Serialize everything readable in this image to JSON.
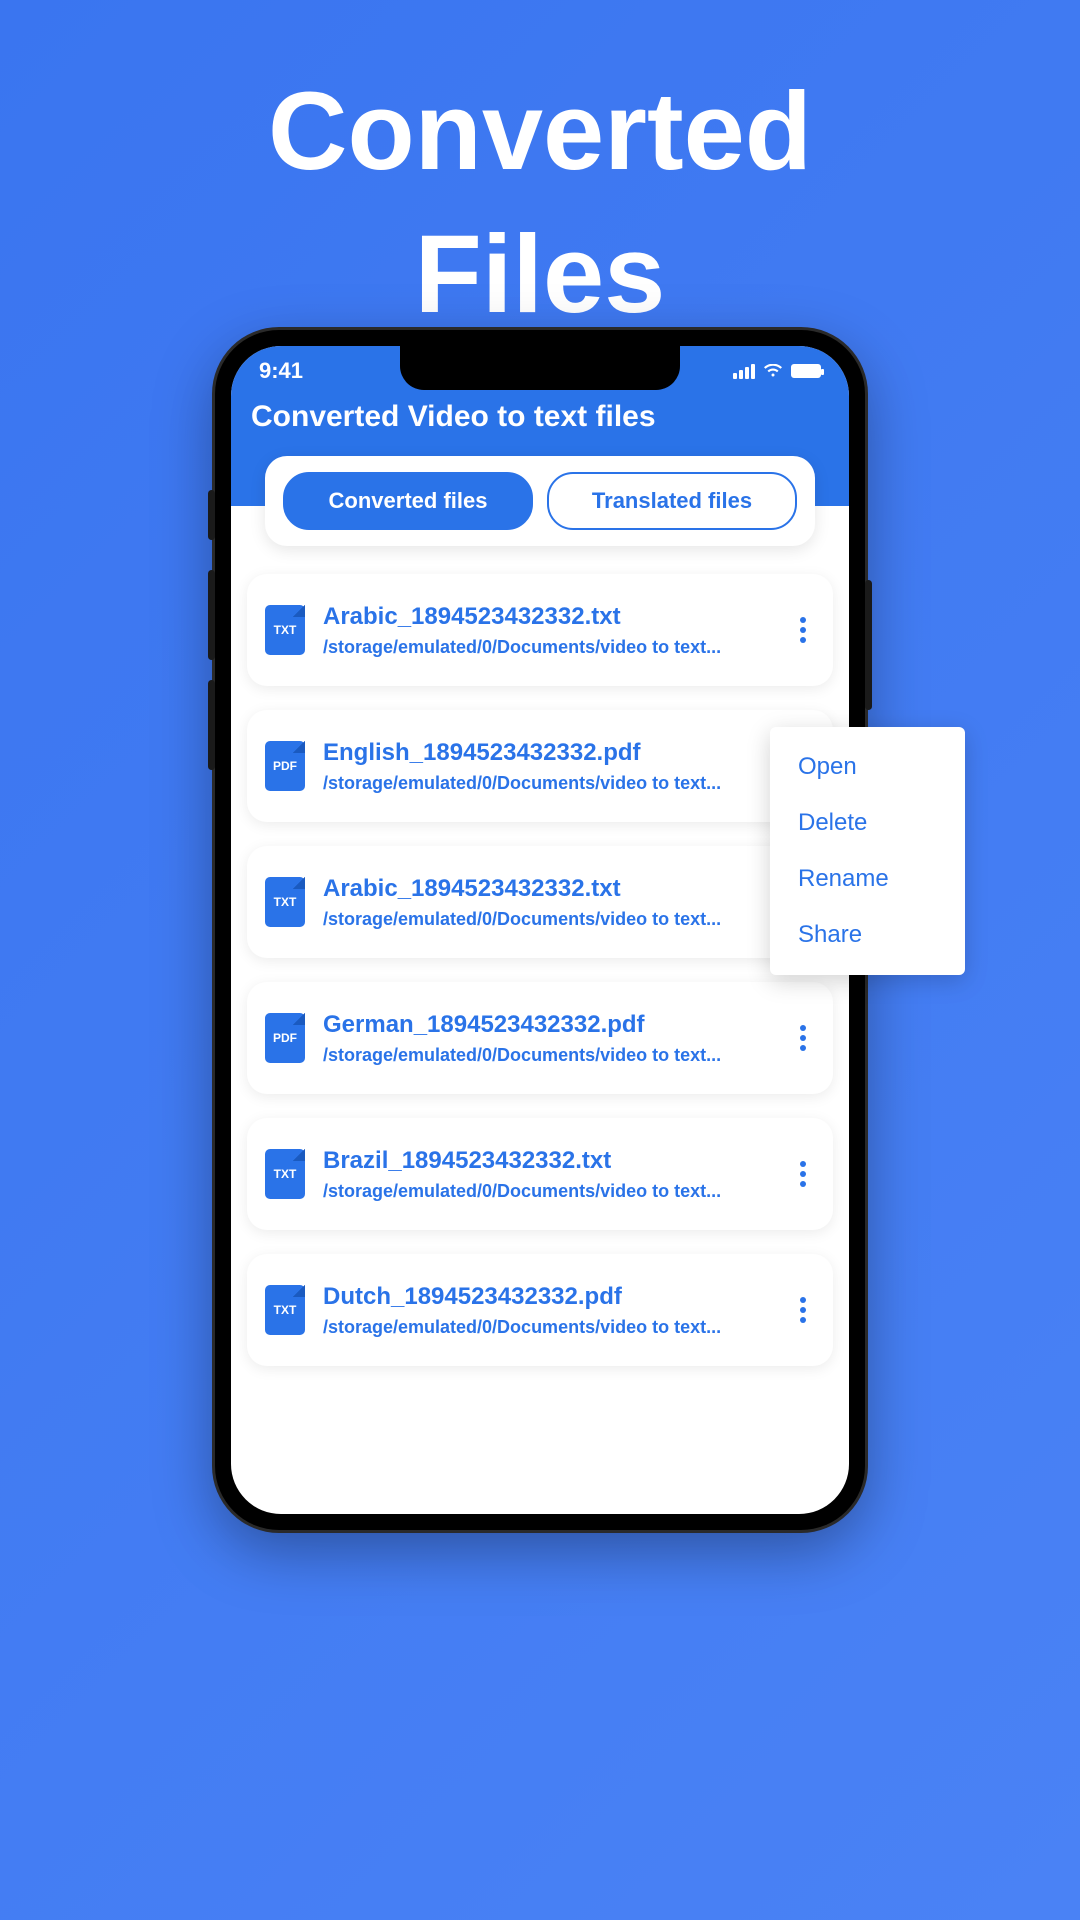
{
  "hero": {
    "line1": "Converted",
    "line2": "Files"
  },
  "status": {
    "time": "9:41"
  },
  "header": {
    "title": "Converted Video to text files"
  },
  "tabs": {
    "converted": "Converted files",
    "translated": "Translated files"
  },
  "files": [
    {
      "name": "Arabic_1894523432332.txt",
      "path": "/storage/emulated/0/Documents/video to text...",
      "type": "TXT"
    },
    {
      "name": "English_1894523432332.pdf",
      "path": "/storage/emulated/0/Documents/video to text...",
      "type": "PDF"
    },
    {
      "name": "Arabic_1894523432332.txt",
      "path": "/storage/emulated/0/Documents/video to text...",
      "type": "TXT"
    },
    {
      "name": "German_1894523432332.pdf",
      "path": "/storage/emulated/0/Documents/video to text...",
      "type": "PDF"
    },
    {
      "name": "Brazil_1894523432332.txt",
      "path": "/storage/emulated/0/Documents/video to text...",
      "type": "TXT"
    },
    {
      "name": "Dutch_1894523432332.pdf",
      "path": "/storage/emulated/0/Documents/video to text...",
      "type": "TXT"
    }
  ],
  "menu": {
    "open": "Open",
    "delete": "Delete",
    "rename": "Rename",
    "share": "Share"
  }
}
